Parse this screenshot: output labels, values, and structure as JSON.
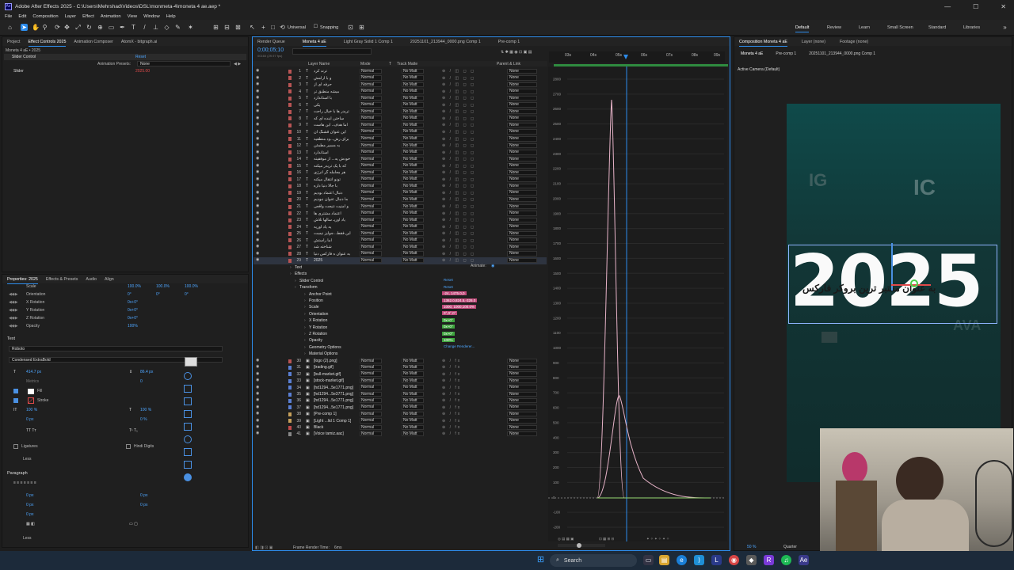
{
  "app": {
    "icon_label": "Ae",
    "title": "Adobe After Effects 2025 - C:\\Users\\Mehrshad\\Videos\\DSL\\monmeta-4\\moneta 4 ae.aep *"
  },
  "window_controls": [
    "—",
    "☐",
    "✕"
  ],
  "menu": [
    "File",
    "Edit",
    "Composition",
    "Layer",
    "Effect",
    "Animation",
    "View",
    "Window",
    "Help"
  ],
  "toolbar": {
    "universal_label": "Universal",
    "snapping_label": "Snapping",
    "workspaces": [
      "Default",
      "Review",
      "Learn",
      "Small Screen",
      "Standard",
      "Libraries"
    ],
    "active_workspace": "Default"
  },
  "left_panel": {
    "tabs": [
      "Project",
      "Effect Controls 2025",
      "Animation Composer",
      "AtomX - bitgraph.ai"
    ],
    "active_tab": "Effect Controls 2025",
    "comp_path": "Moneta 4 aE • 2025",
    "effect_name": "Slider Control",
    "reset_label": "Reset",
    "animation_presets_label": "Animation Presets:",
    "animation_presets_value": "None",
    "slider_label": "Slider",
    "slider_value": "2025.00"
  },
  "properties_panel": {
    "tabs": [
      "Properties: 2025",
      "Effects & Presets",
      "Audio",
      "Align"
    ],
    "active_tab": "Properties: 2025",
    "scale_label": "Scale",
    "scale_values": [
      "100.0%",
      "100.0%",
      "100.0%"
    ],
    "transform_rows": [
      {
        "label": "Orientation",
        "values": [
          "0°",
          "0°",
          "0°"
        ]
      },
      {
        "label": "X Rotation",
        "values": [
          "0x+0°"
        ]
      },
      {
        "label": "Y Rotation",
        "values": [
          "0x+0°"
        ]
      },
      {
        "label": "Z Rotation",
        "values": [
          "0x+0°"
        ]
      },
      {
        "label": "Opacity",
        "values": [
          "100%"
        ]
      }
    ],
    "text_section": "Text",
    "font_family": "Roboto",
    "font_style": "Condensed ExtraBold",
    "font_size": "414.7 px",
    "leading": "86.4 px",
    "metrics_label": "Metrics",
    "tracking": "0",
    "fill_label": "Fill",
    "stroke_label": "Stroke",
    "vert_scale": "100 %",
    "horiz_scale": "100 %",
    "baseline": "0 px",
    "tsume": "0 %",
    "ligatures_label": "Ligatures",
    "hindi_digits_label": "Hindi Digits",
    "less_label": "Less",
    "paragraph_section": "Paragraph",
    "paragraph_values": [
      "0 px",
      "0 px",
      "0 px",
      "0 px",
      "0 px"
    ],
    "less_label_2": "Less"
  },
  "timeline": {
    "tabs": [
      "Render Queue",
      "Moneta 4 aE",
      "Light Gray Solid 1 Comp 1",
      "20251101_213944_0000.png Comp 1",
      "Pre-comp 1"
    ],
    "active_tab": "Moneta 4 aE",
    "timecode": "0;00;05;10",
    "frames": "00160 (29.97 fps)",
    "columns": [
      "Layer Name",
      "Mode",
      "T",
      "Track Matte",
      "Parent & Link"
    ],
    "ruler_ticks": [
      "03s",
      "04s",
      "05s",
      "06s",
      "07s",
      "08s",
      "09s"
    ],
    "layers": [
      {
        "num": "1",
        "type": "T",
        "name": "ترند کرد",
        "color": "#b85454",
        "mode": "Normal",
        "matte": "No Matt",
        "parent": "None"
      },
      {
        "num": "2",
        "type": "T",
        "name": "و با آرامش",
        "color": "#b85454",
        "mode": "Normal",
        "matte": "No Matt",
        "parent": "None"
      },
      {
        "num": "3",
        "type": "T",
        "name": "حرفه ای از",
        "color": "#b85454",
        "mode": "Normal",
        "matte": "No Matt",
        "parent": "None"
      },
      {
        "num": "4",
        "type": "T",
        "name": "میشه منطبق تر",
        "color": "#b85454",
        "mode": "Normal",
        "matte": "No Matt",
        "parent": "None"
      },
      {
        "num": "5",
        "type": "T",
        "name": "با استاندارد",
        "color": "#b85454",
        "mode": "Normal",
        "matte": "No Matt",
        "parent": "None"
      },
      {
        "num": "6",
        "type": "T",
        "name": "یکی",
        "color": "#b85454",
        "mode": "Normal",
        "matte": "No Matt",
        "parent": "None"
      },
      {
        "num": "7",
        "type": "T",
        "name": "تریدر ها با خیال راحت",
        "color": "#b85454",
        "mode": "Normal",
        "matte": "No Matt",
        "parent": "None"
      },
      {
        "num": "8",
        "type": "T",
        "name": "ساختن آینده ای که",
        "color": "#b85454",
        "mode": "Normal",
        "matte": "No Matt",
        "parent": "None"
      },
      {
        "num": "9",
        "type": "T",
        "name": "اما هدف.. این هاست",
        "color": "#b85454",
        "mode": "Normal",
        "matte": "No Matt",
        "parent": "None"
      },
      {
        "num": "10",
        "type": "T",
        "name": "این عنوان قشنگ ان",
        "color": "#b85454",
        "mode": "Normal",
        "matte": "No Matt",
        "parent": "None"
      },
      {
        "num": "11",
        "type": "T",
        "name": "برای رش...ود منطقیه",
        "color": "#b85454",
        "mode": "Normal",
        "matte": "No Matt",
        "parent": "None"
      },
      {
        "num": "12",
        "type": "T",
        "name": "به مسیر مطمئن",
        "color": "#b85454",
        "mode": "Normal",
        "matte": "No Matt",
        "parent": "None"
      },
      {
        "num": "13",
        "type": "T",
        "name": "استاندارد",
        "color": "#b85454",
        "mode": "Normal",
        "matte": "No Matt",
        "parent": "None"
      },
      {
        "num": "14",
        "type": "T",
        "name": "خودش یه... از موفقیته",
        "color": "#b85454",
        "mode": "Normal",
        "matte": "No Matt",
        "parent": "None"
      },
      {
        "num": "15",
        "type": "T",
        "name": "که با یک تریدر میکنه",
        "color": "#b85454",
        "mode": "Normal",
        "matte": "No Matt",
        "parent": "None"
      },
      {
        "num": "16",
        "type": "T",
        "name": "هر معامله گر انرژی",
        "color": "#b85454",
        "mode": "Normal",
        "matte": "No Matt",
        "parent": "None"
      },
      {
        "num": "17",
        "type": "T",
        "name": "تونو انتقال میکنه",
        "color": "#b85454",
        "mode": "Normal",
        "matte": "No Matt",
        "parent": "None"
      },
      {
        "num": "18",
        "type": "T",
        "name": "با جالا دنیا داره",
        "color": "#b85454",
        "mode": "Normal",
        "matte": "No Matt",
        "parent": "None"
      },
      {
        "num": "19",
        "type": "T",
        "name": "دنبال اعتماد بودیم",
        "color": "#b85454",
        "mode": "Normal",
        "matte": "No Matt",
        "parent": "None"
      },
      {
        "num": "20",
        "type": "T",
        "name": "ما دنبال عنوان نبودیم",
        "color": "#b85454",
        "mode": "Normal",
        "matte": "No Matt",
        "parent": "None"
      },
      {
        "num": "21",
        "type": "T",
        "name": "و امنیت نتیجت واقعی",
        "color": "#b85454",
        "mode": "Normal",
        "matte": "No Matt",
        "parent": "None"
      },
      {
        "num": "22",
        "type": "T",
        "name": "اعتماد مشتری ها",
        "color": "#b85454",
        "mode": "Normal",
        "matte": "No Matt",
        "parent": "None"
      },
      {
        "num": "23",
        "type": "T",
        "name": "یاد اوریـ سالها تلاش",
        "color": "#b85454",
        "mode": "Normal",
        "matte": "No Matt",
        "parent": "None"
      },
      {
        "num": "24",
        "type": "T",
        "name": "یه یاد اوریه",
        "color": "#b85454",
        "mode": "Normal",
        "matte": "No Matt",
        "parent": "None"
      },
      {
        "num": "25",
        "type": "T",
        "name": "این فقط...جوایز نیست",
        "color": "#b85454",
        "mode": "Normal",
        "matte": "No Matt",
        "parent": "None"
      },
      {
        "num": "26",
        "type": "T",
        "name": "اما راستش",
        "color": "#b85454",
        "mode": "Normal",
        "matte": "No Matt",
        "parent": "None"
      },
      {
        "num": "27",
        "type": "T",
        "name": "شناخته شد",
        "color": "#b85454",
        "mode": "Normal",
        "matte": "No Matt",
        "parent": "None"
      },
      {
        "num": "28",
        "type": "T",
        "name": "به عنوان ه فارکس دنیا",
        "color": "#b85454",
        "mode": "Normal",
        "matte": "No Matt",
        "parent": "None"
      },
      {
        "num": "29",
        "type": "T",
        "name": "2025",
        "color": "#b85454",
        "mode": "Normal",
        "matte": "No Matt",
        "parent": "None"
      }
    ],
    "animate_label": "Animate:",
    "expanded_props": [
      {
        "name": "Text",
        "value": ""
      },
      {
        "name": "Effects",
        "value": ""
      },
      {
        "name": "Slider Control",
        "value": "Reset"
      },
      {
        "name": "Transform",
        "value": "Reset"
      },
      {
        "name": "Anchor Point",
        "value": "-24, 1475.0,0"
      },
      {
        "name": "Position",
        "value": "1362.0,824.5,-326.0"
      },
      {
        "name": "Scale",
        "value": "1000, 1000,100.0%"
      },
      {
        "name": "Orientation",
        "value": "0°,0°,0°"
      },
      {
        "name": "X Rotation",
        "value": "0x+0°"
      },
      {
        "name": "Y Rotation",
        "value": "0x+0°"
      },
      {
        "name": "Z Rotation",
        "value": "0x+0°"
      },
      {
        "name": "Opacity",
        "value": "100%"
      },
      {
        "name": "Geometry Options",
        "value": "Change Renderer..."
      },
      {
        "name": "Material Options",
        "value": ""
      }
    ],
    "lower_layers": [
      {
        "num": "30",
        "name": "[logo (2).png]",
        "color": "#b85454"
      },
      {
        "num": "31",
        "name": "[trading.gif]",
        "color": "#5a7fd4"
      },
      {
        "num": "32",
        "name": "[bull-market.gif]",
        "color": "#5a7fd4"
      },
      {
        "num": "33",
        "name": "[stock-market.gif]",
        "color": "#5a7fd4"
      },
      {
        "num": "34",
        "name": "[hd1294...5e1771.png]",
        "color": "#5a7fd4"
      },
      {
        "num": "35",
        "name": "[hd1294...5e3771.png]",
        "color": "#5a7fd4"
      },
      {
        "num": "36",
        "name": "[hd1294...5e1771.png]",
        "color": "#5a7fd4"
      },
      {
        "num": "37",
        "name": "[hd1294...5e1771.png]",
        "color": "#5a7fd4"
      },
      {
        "num": "38",
        "name": "[Pre-comp 1]",
        "color": "#c7a05a"
      },
      {
        "num": "39",
        "name": "[Light ...lid 1 Comp 1]",
        "color": "#c7a05a"
      },
      {
        "num": "40",
        "name": "Black",
        "color": "#c04a4a"
      },
      {
        "num": "41",
        "name": "[Voice tamiz.aac]",
        "color": "#888888"
      }
    ],
    "frame_render_label": "Frame Render Time:",
    "frame_render_value": "6ms"
  },
  "graph_editor": {
    "y_labels": [
      "2800",
      "2700",
      "2600",
      "2500",
      "2400",
      "2300",
      "2200",
      "2100",
      "2000",
      "1900",
      "1800",
      "1700",
      "1600",
      "1500",
      "1400",
      "1300",
      "1200",
      "1100",
      "1000",
      "900",
      "800",
      "700",
      "600",
      "500",
      "400",
      "300",
      "200",
      "100",
      "0",
      "-100",
      "-200"
    ],
    "curve_color": "#e7b3c8",
    "baseline_color": "#8fd16b"
  },
  "right_panel": {
    "tabs": [
      "Composition Moneta 4 aE",
      "Layer (none)",
      "Footage (none)"
    ],
    "active_tab": "Composition Moneta 4 aE",
    "breadcrumbs": [
      "Moneta 4 aE",
      "Pre-comp 1",
      "20251101_213944_0000.png Comp 1"
    ],
    "camera_label": "Active Camera (Default)",
    "big_year": "2025",
    "overlay_text": "به عنوان معتبر ترین بروکر فارکس",
    "zoom": "50 %",
    "quality": "Quarter"
  },
  "taskbar": {
    "search_placeholder": "Search"
  }
}
